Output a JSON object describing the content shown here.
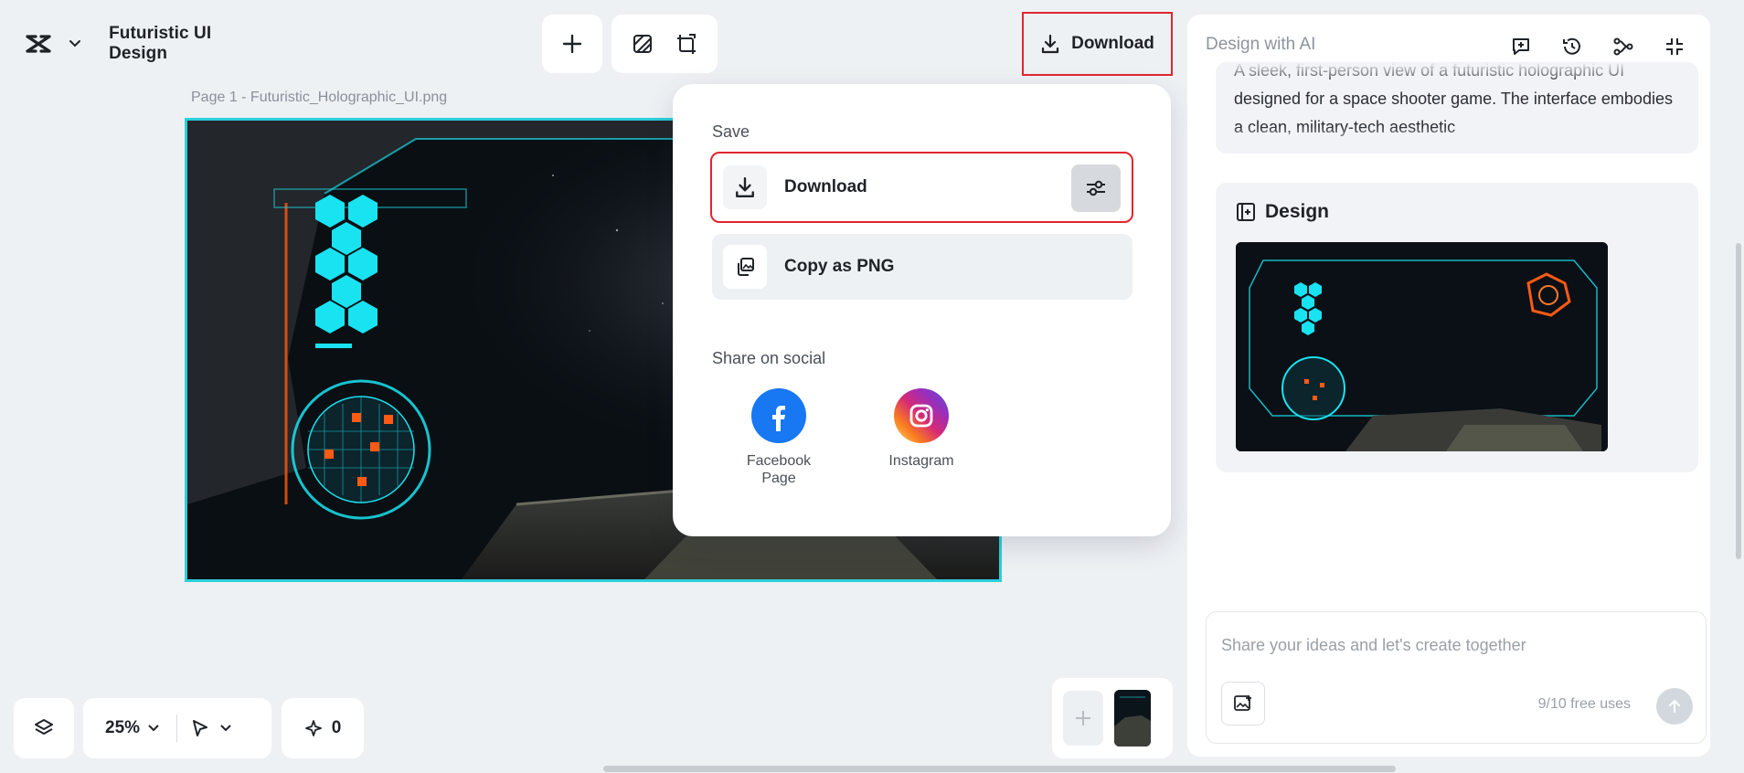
{
  "header": {
    "project_title": "Futuristic UI Design",
    "download_label": "Download"
  },
  "canvas": {
    "page_label": "Page 1 -   Futuristic_Holographic_UI.png"
  },
  "download_menu": {
    "save_heading": "Save",
    "download_label": "Download",
    "copy_label": "Copy as PNG",
    "share_heading": "Share on social",
    "social": [
      {
        "label": "Facebook Page",
        "color": "#1877f2"
      },
      {
        "label": "Instagram",
        "color": "#d62976"
      }
    ]
  },
  "ai_panel": {
    "title": "Design with AI",
    "prompt_text": "A sleek, first-person view of a futuristic holographic UI designed for a space shooter game. The interface embodies a clean, military-tech aesthetic",
    "design_heading": "Design",
    "chat_placeholder": "Share your ideas and let's create together",
    "free_uses": "9/10 free uses"
  },
  "bottom_bar": {
    "zoom": "25%",
    "spark_count": "0"
  },
  "colors": {
    "highlight": "#e0262f",
    "canvas_selection": "#2ccfd9",
    "hud_cyan": "#19e3f0",
    "hud_orange": "#ff5a14"
  }
}
